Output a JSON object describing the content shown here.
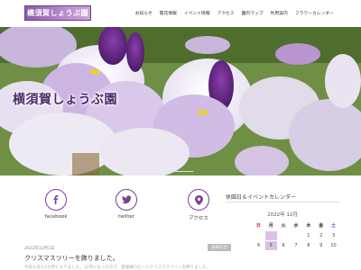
{
  "header": {
    "logo_text": "横須賀しょうぶ園",
    "nav": [
      "お知らせ",
      "開花情報",
      "イベント情報",
      "アクセス",
      "園内マップ",
      "利用案内",
      "フラワーカレンダー"
    ]
  },
  "hero": {
    "title": "横須賀しょうぶ園"
  },
  "social": [
    {
      "label": "facebook",
      "icon": "facebook-icon"
    },
    {
      "label": "twitter",
      "icon": "twitter-icon"
    },
    {
      "label": "アクセス",
      "icon": "map-pin-icon"
    }
  ],
  "post": {
    "date": "2022年12月1日",
    "title": "クリスマスツリーを飾りました。",
    "excerpt": "今年もあと1か月となりました。12月になったので、管理棟ロビーにクリスマスツリーを飾りました。",
    "badge": "お知らせ"
  },
  "calendar": {
    "title": "休園日＆イベントカレンダー",
    "month": "2022年 12月",
    "weekdays": [
      "日",
      "月",
      "火",
      "水",
      "木",
      "金",
      "土"
    ],
    "days": [
      "",
      "",
      "",
      "",
      "1",
      "2",
      "3",
      "4",
      "5",
      "6",
      "7",
      "8",
      "9",
      "10"
    ]
  },
  "colors": {
    "brand": "#7b3f93",
    "closed": "#d7c3e6"
  }
}
